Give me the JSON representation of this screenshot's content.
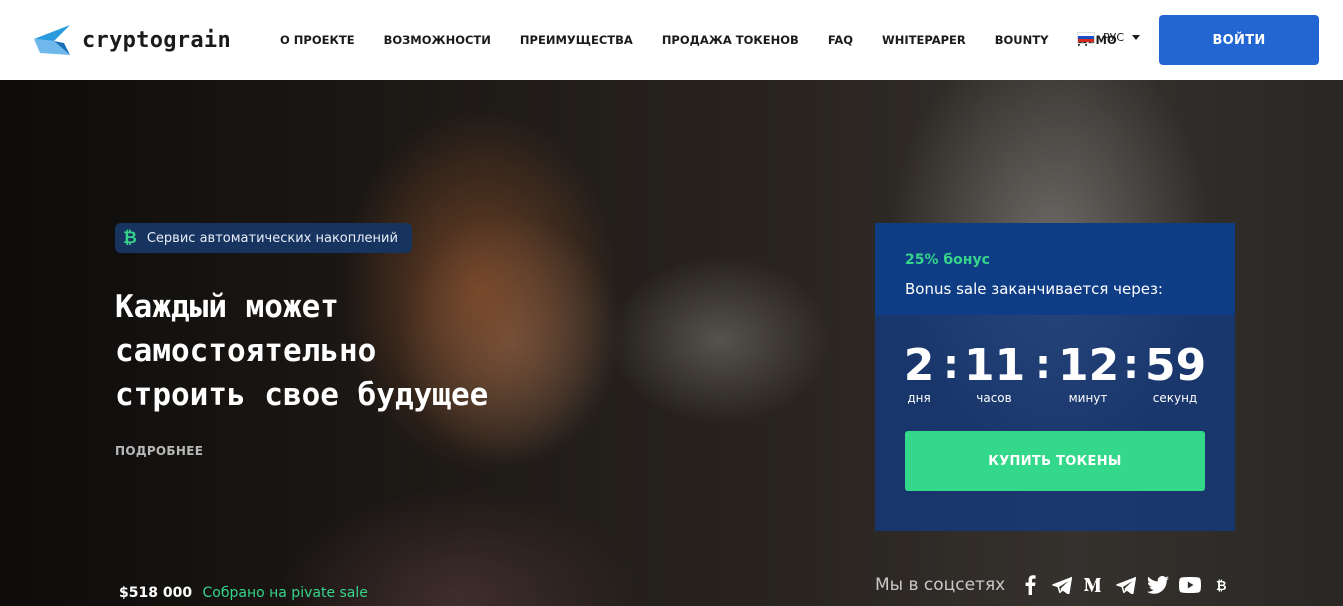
{
  "header": {
    "brand": "cryptograin",
    "nav": [
      "О ПРОЕКТЕ",
      "ВОЗМОЖНОСТИ",
      "ПРЕИМУЩЕСТВА",
      "ПРОДАЖА ТОКЕНОВ",
      "FAQ",
      "WHITEPAPER",
      "BOUNTY",
      "ДЕМО"
    ],
    "language": "РУС",
    "login_label": "ВОЙТИ"
  },
  "hero": {
    "badge_text": "Сервис автоматических накоплений",
    "headline": [
      "Каждый может",
      "самостоятельно",
      "строить свое будущее"
    ],
    "more_link": "ПОДРОБНЕЕ",
    "raised_amount": "$518 000",
    "raised_label": "Собрано на pivate sale"
  },
  "countdown": {
    "bonus_title": "25% бонус",
    "bonus_subtitle": "Bonus sale заканчивается через:",
    "units": [
      {
        "value": "2",
        "label": "дня"
      },
      {
        "value": "11",
        "label": "часов"
      },
      {
        "value": "12",
        "label": "минут"
      },
      {
        "value": "59",
        "label": "секунд"
      }
    ],
    "separator": ":",
    "buy_label": "КУПИТЬ ТОКЕНЫ"
  },
  "socials": {
    "label": "Мы в соцсетях",
    "icons": [
      "facebook-icon",
      "telegram-icon",
      "medium-icon",
      "telegram-icon",
      "twitter-icon",
      "youtube-icon",
      "bitcointalk-icon"
    ]
  },
  "colors": {
    "primary_blue": "#2366d1",
    "panel_blue": "#0e3d86",
    "accent_green": "#34d88b"
  }
}
